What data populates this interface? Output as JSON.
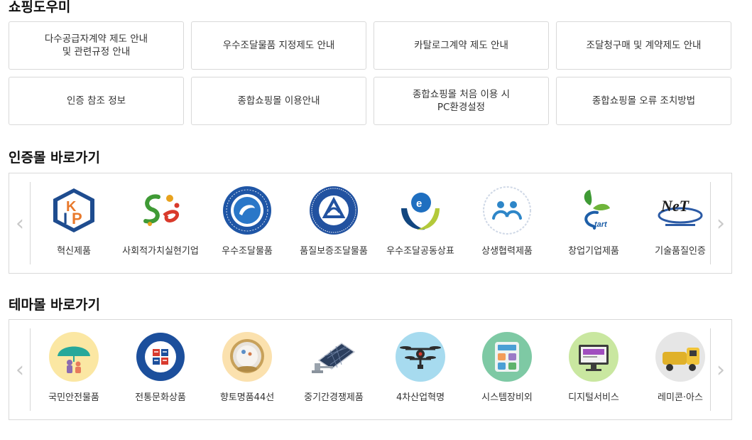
{
  "shopping_help": {
    "title": "쇼핑도우미",
    "buttons": [
      "다수공급자계약 제도 안내\n및 관련규정 안내",
      "우수조달물품 지정제도 안내",
      "카탈로그계약 제도 안내",
      "조달청구매 및 계약제도 안내",
      "인증 참조 정보",
      "종합쇼핑몰 이용안내",
      "종합쇼핑몰 처음 이용 시\nPC환경설정",
      "종합쇼핑몰 오류 조치방법"
    ]
  },
  "cert_mall": {
    "title": "인증몰 바로가기",
    "items": [
      {
        "label": "혁신제품",
        "icon": "kip-innovation-logo"
      },
      {
        "label": "사회적가치실현기업",
        "icon": "social-value-se-logo"
      },
      {
        "label": "우수조달물품",
        "icon": "excellent-procurement-seal"
      },
      {
        "label": "품질보증조달물품",
        "icon": "quality-assurance-seal"
      },
      {
        "label": "우수조달공동상표",
        "icon": "joint-brand-logo"
      },
      {
        "label": "상생협력제품",
        "icon": "win-win-cooperation-logo"
      },
      {
        "label": "창업기업제품",
        "icon": "startup-sprout-logo"
      },
      {
        "label": "기술품질인증",
        "icon": "net-technology-logo"
      }
    ],
    "prev_icon": "chevron-left-icon",
    "next_icon": "chevron-right-icon"
  },
  "theme_mall": {
    "title": "테마몰 바로가기",
    "items": [
      {
        "label": "국민안전물품",
        "icon": "umbrella-family-icon"
      },
      {
        "label": "전통문화상품",
        "icon": "traditional-culture-seal"
      },
      {
        "label": "향토명품44선",
        "icon": "local-specialty-bowl-icon"
      },
      {
        "label": "중기간경쟁제품",
        "icon": "solar-panel-icon"
      },
      {
        "label": "4차산업혁명",
        "icon": "drone-icon"
      },
      {
        "label": "시스템장비외",
        "icon": "calculator-icon"
      },
      {
        "label": "디지털서비스",
        "icon": "monitor-icon"
      },
      {
        "label": "레미콘·아스",
        "icon": "mixer-truck-icon"
      }
    ],
    "prev_icon": "chevron-left-icon",
    "next_icon": "chevron-right-icon"
  },
  "colors": {
    "border": "#d9d9d9",
    "arrow": "#c9c9c9",
    "kip_blue": "#1e4c8f",
    "kip_orange": "#e8792b",
    "seal_blue": "#1f56a6",
    "green": "#3f9a35",
    "sky_blue": "#4b9fd5"
  }
}
